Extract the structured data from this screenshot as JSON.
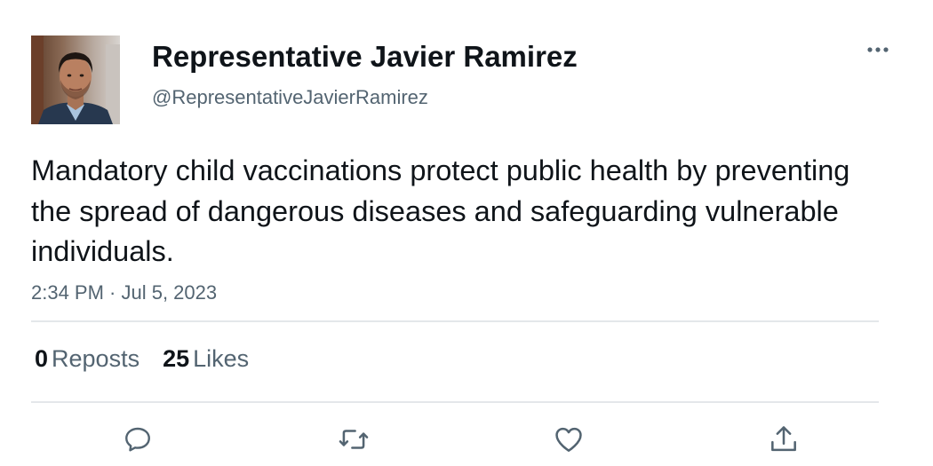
{
  "author": {
    "display_name": "Representative Javier Ramirez",
    "handle": "@RepresentativeJavierRamirez"
  },
  "tweet": {
    "text": "Mandatory child vaccinations protect public health by preventing the spread of dangerous diseases and safeguarding vulnerable individuals.",
    "timestamp": "2:34 PM · Jul 5, 2023"
  },
  "stats": {
    "reposts_count": "0",
    "reposts_label": "Reposts",
    "likes_count": "25",
    "likes_label": "Likes"
  },
  "icons": {
    "more": "more-horizontal-icon",
    "reply": "reply-bubble-icon",
    "repost": "repost-arrows-icon",
    "like": "heart-icon",
    "share": "share-upload-icon"
  },
  "colors": {
    "text_primary": "#0f1419",
    "text_secondary": "#536471",
    "divider": "#e4e7ea"
  }
}
